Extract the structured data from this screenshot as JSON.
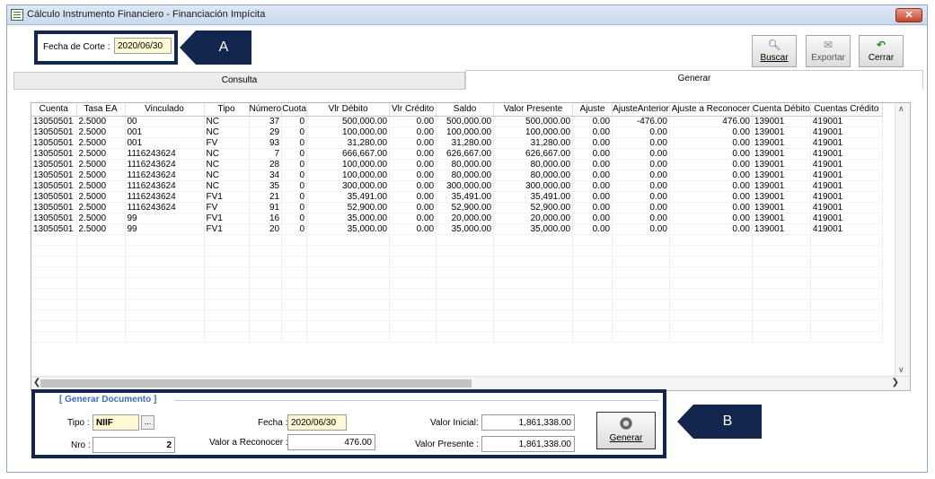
{
  "window": {
    "title": "Cálculo Instrumento Financiero - Financiación Impícita",
    "close_icon": "close-icon"
  },
  "fecha_corte": {
    "label": "Fecha de Corte :",
    "value": "2020/06/30"
  },
  "callouts": {
    "a": "A",
    "b": "B"
  },
  "toolbar": {
    "buscar": "Buscar",
    "exportar": "Exportar",
    "cerrar": "Cerrar"
  },
  "tabs": [
    {
      "label": "Consulta",
      "active": false
    },
    {
      "label": "Generar",
      "active": true
    }
  ],
  "grid": {
    "columns": [
      "Cuenta",
      "Tasa EA",
      "Vinculado",
      "Tipo",
      "Número",
      "Cuota",
      "Vlr Débito",
      "Vlr Crédito",
      "Saldo",
      "Valor Presente",
      "Ajuste",
      "AjusteAnterior",
      "Ajuste a Reconocer",
      "Cuenta Débito",
      "Cuentas Crédito"
    ],
    "rows": [
      [
        "13050501",
        "2.5000",
        "00",
        "NC",
        "37",
        "0",
        "500,000.00",
        "0.00",
        "500,000.00",
        "500,000.00",
        "0.00",
        "-476.00",
        "476.00",
        "139001",
        "419001"
      ],
      [
        "13050501",
        "2.5000",
        "001",
        "NC",
        "29",
        "0",
        "100,000.00",
        "0.00",
        "100,000.00",
        "100,000.00",
        "0.00",
        "0.00",
        "0.00",
        "139001",
        "419001"
      ],
      [
        "13050501",
        "2.5000",
        "001",
        "FV",
        "93",
        "0",
        "31,280.00",
        "0.00",
        "31,280.00",
        "31,280.00",
        "0.00",
        "0.00",
        "0.00",
        "139001",
        "419001"
      ],
      [
        "13050501",
        "2.5000",
        "1116243624",
        "NC",
        "7",
        "0",
        "666,667.00",
        "0.00",
        "626,667.00",
        "626,667.00",
        "0.00",
        "0.00",
        "0.00",
        "139001",
        "419001"
      ],
      [
        "13050501",
        "2.5000",
        "1116243624",
        "NC",
        "28",
        "0",
        "100,000.00",
        "0.00",
        "80,000.00",
        "80,000.00",
        "0.00",
        "0.00",
        "0.00",
        "139001",
        "419001"
      ],
      [
        "13050501",
        "2.5000",
        "1116243624",
        "NC",
        "34",
        "0",
        "100,000.00",
        "0.00",
        "80,000.00",
        "80,000.00",
        "0.00",
        "0.00",
        "0.00",
        "139001",
        "419001"
      ],
      [
        "13050501",
        "2.5000",
        "1116243624",
        "NC",
        "35",
        "0",
        "300,000.00",
        "0.00",
        "300,000.00",
        "300,000.00",
        "0.00",
        "0.00",
        "0.00",
        "139001",
        "419001"
      ],
      [
        "13050501",
        "2.5000",
        "1116243624",
        "FV1",
        "21",
        "0",
        "35,491.00",
        "0.00",
        "35,491.00",
        "35,491.00",
        "0.00",
        "0.00",
        "0.00",
        "139001",
        "419001"
      ],
      [
        "13050501",
        "2.5000",
        "1116243624",
        "FV",
        "91",
        "0",
        "52,900.00",
        "0.00",
        "52,900.00",
        "52,900.00",
        "0.00",
        "0.00",
        "0.00",
        "139001",
        "419001"
      ],
      [
        "13050501",
        "2.5000",
        "99",
        "FV1",
        "16",
        "0",
        "35,000.00",
        "0.00",
        "20,000.00",
        "20,000.00",
        "0.00",
        "0.00",
        "0.00",
        "139001",
        "419001"
      ],
      [
        "13050501",
        "2.5000",
        "99",
        "FV1",
        "20",
        "0",
        "35,000.00",
        "0.00",
        "35,000.00",
        "35,000.00",
        "0.00",
        "0.00",
        "0.00",
        "139001",
        "419001"
      ]
    ]
  },
  "generar_documento": {
    "title": "[ Generar Documento ]",
    "tipo_label": "Tipo :",
    "tipo_value": "NIIF",
    "dots": "...",
    "nro_label": "Nro :",
    "nro_value": "2",
    "fecha_label": "Fecha :",
    "fecha_value": "2020/06/30",
    "valor_reconocer_label": "Valor a Reconocer :",
    "valor_reconocer_value": "476.00",
    "valor_inicial_label": "Valor Inicial:",
    "valor_inicial_value": "1,861,338.00",
    "valor_presente_label": "Valor Presente :",
    "valor_presente_value": "1,861,338.00",
    "generar_button": "Generar"
  }
}
